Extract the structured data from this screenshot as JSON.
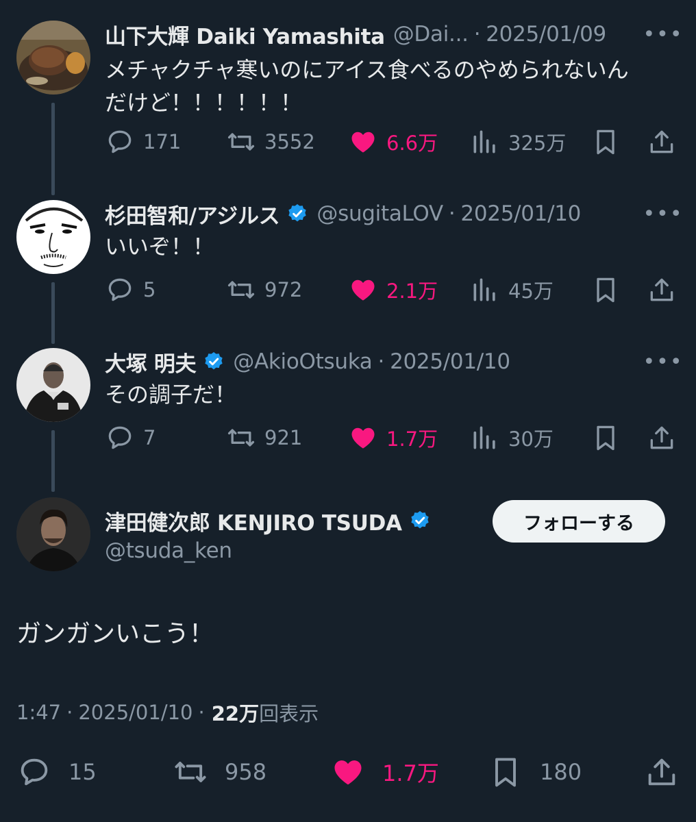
{
  "replies": [
    {
      "name": "山下大輝 Daiki Yamashita",
      "handle": "@Dai...",
      "date": "2025/01/09",
      "verified": false,
      "text_lines": [
        "メチャクチャ寒いのにアイス食べるのやめられないん",
        "だけど！！！！！！"
      ],
      "stats": {
        "replies": "171",
        "retweets": "3552",
        "likes": "6.6万",
        "views": "325万"
      },
      "avatar_icon": "steak-photo-avatar"
    },
    {
      "name": "杉田智和/アジルス",
      "handle": "@sugitaLOV",
      "date": "2025/01/10",
      "verified": true,
      "text_lines": [
        "いいぞ！！"
      ],
      "stats": {
        "replies": "5",
        "retweets": "972",
        "likes": "2.1万",
        "views": "45万"
      },
      "avatar_icon": "sketch-face-avatar"
    },
    {
      "name": "大塚 明夫",
      "handle": "@AkioOtsuka",
      "date": "2025/01/10",
      "verified": true,
      "text_lines": [
        "その調子だ！"
      ],
      "stats": {
        "replies": "7",
        "retweets": "921",
        "likes": "1.7万",
        "views": "30万"
      },
      "avatar_icon": "man-in-suit-avatar"
    }
  ],
  "main_tweet": {
    "name": "津田健次郎 KENJIRO TSUDA",
    "handle": "@tsuda_ken",
    "verified": true,
    "follow_label": "フォローする",
    "text": "ガンガンいこう！",
    "time": "1:47",
    "date": "2025/01/10",
    "views_num": "22万",
    "views_label": "回表示",
    "stats": {
      "replies": "15",
      "retweets": "958",
      "likes": "1.7万",
      "bookmarks": "180"
    }
  },
  "separator": "·",
  "more_glyph": "•••",
  "colors": {
    "background": "#16202a",
    "like": "#f91880",
    "verified": "#1d9bf0",
    "muted": "#8b98a5"
  }
}
